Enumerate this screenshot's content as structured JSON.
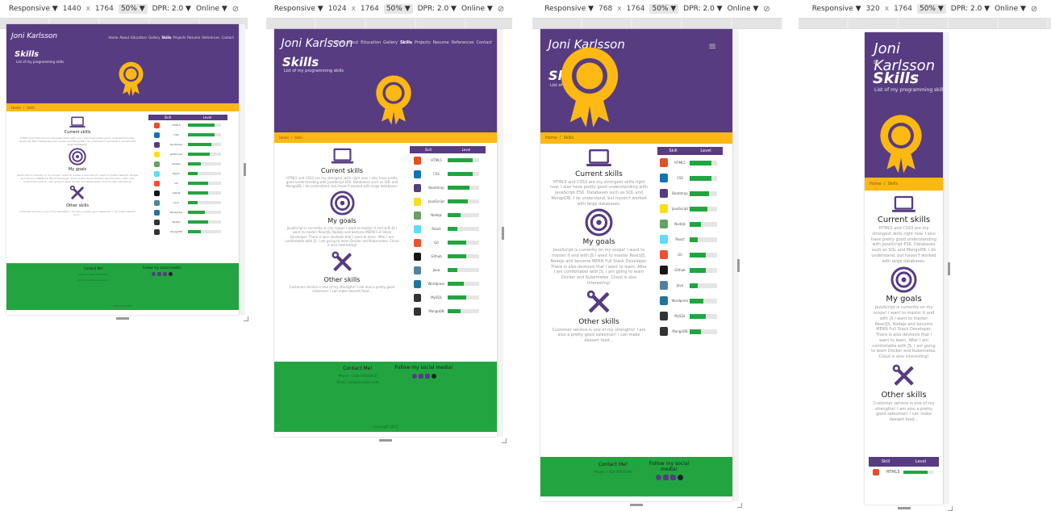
{
  "site": {
    "brand": "Joni Karlsson",
    "nav": [
      "Home",
      "About",
      "Education",
      "Gallery",
      "Skills",
      "Projects",
      "Resume",
      "References",
      "Contact"
    ],
    "active_nav": "Skills",
    "page_title": "Skills",
    "page_subtitle": "List of my programming skills",
    "breadcrumb_home": "Home",
    "breadcrumb_sep": "/",
    "breadcrumb_current": "Skills",
    "sections": {
      "current": {
        "title": "Current skills",
        "text": "HTML5 and CSS3 are my strongest skills right now. I also have pretty good understanding with JavaScript ES6. Databases such as SQL and MongoDB, I do understand, but haven't worked with large databases."
      },
      "goals": {
        "title": "My goals",
        "text": "JavaScript is currently on my scope! I want to master it and with JS I want to master ReactJS, NodeJs and become MERN Full Stack Developer. There is also devtools that I want to learn. After I am comfortable with JS, I am going to learn Docker and Kubernetes. Cloud is also interesting!"
      },
      "other": {
        "title": "Other skills",
        "text": "Customer service is one of my strengths! I am also a pretty good salesman! I can make dessert food..."
      }
    },
    "skills_header": {
      "skill": "Skill",
      "level": "Level"
    },
    "skills": [
      {
        "name": "HTML5",
        "level": 0.8,
        "color": "#e34f26",
        "icon": "html5-icon"
      },
      {
        "name": "CSS",
        "level": 0.8,
        "color": "#1572b6",
        "icon": "css3-icon"
      },
      {
        "name": "Bootstrap",
        "level": 0.7,
        "color": "#563d7c",
        "icon": "bootstrap-icon"
      },
      {
        "name": "JavaScript",
        "level": 0.65,
        "color": "#f7df1e",
        "icon": "javascript-icon"
      },
      {
        "name": "NodeJs",
        "level": 0.4,
        "color": "#689f63",
        "icon": "nodejs-icon"
      },
      {
        "name": "React",
        "level": 0.3,
        "color": "#61dafb",
        "icon": "react-icon"
      },
      {
        "name": "Git",
        "level": 0.6,
        "color": "#f05032",
        "icon": "git-icon"
      },
      {
        "name": "Github",
        "level": 0.6,
        "color": "#181717",
        "icon": "github-icon"
      },
      {
        "name": "Java",
        "level": 0.3,
        "color": "#5382a1",
        "icon": "java-icon"
      },
      {
        "name": "Wordpress",
        "level": 0.5,
        "color": "#21759b",
        "icon": "wordpress-icon"
      },
      {
        "name": "MySQL",
        "level": 0.6,
        "color": "#333333",
        "icon": "mysql-icon"
      },
      {
        "name": "MongoDB",
        "level": 0.4,
        "color": "#333333",
        "icon": "mongodb-icon"
      }
    ],
    "footer": {
      "contact_title": "Contact Me!",
      "phone": "Phone: +358 00000000",
      "email": "Email: joni@example.com",
      "social_title": "Follow my social media!",
      "copyright": "Copyright 2021"
    }
  },
  "devtools": [
    {
      "mode": "Responsive ▼",
      "width": "1440",
      "x": "x",
      "height": "1764",
      "zoom": "50% ▼",
      "dpr": "DPR: 2.0 ▼",
      "net": "Online ▼"
    },
    {
      "mode": "Responsive ▼",
      "width": "1024",
      "x": "x",
      "height": "1764",
      "zoom": "50% ▼",
      "dpr": "DPR: 2.0 ▼",
      "net": "Online ▼"
    },
    {
      "mode": "Responsive ▼",
      "width": "768",
      "x": "x",
      "height": "1764",
      "zoom": "50% ▼",
      "dpr": "DPR: 2.0 ▼",
      "net": "Online ▼"
    },
    {
      "mode": "Responsive ▼",
      "width": "320",
      "x": "x",
      "height": "1764",
      "zoom": "50% ▼",
      "dpr": "DPR: 2.0 ▼",
      "net": "Online ▼"
    }
  ],
  "colors": {
    "purple": "#573c82",
    "yellow": "#fdb813",
    "green": "#22a541"
  }
}
